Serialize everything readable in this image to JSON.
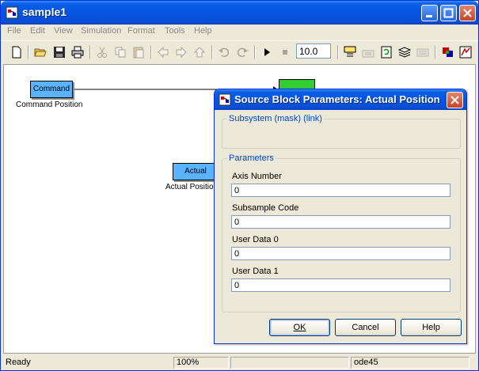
{
  "window": {
    "title": "sample1",
    "icon": "simulink-model-icon"
  },
  "menu": [
    "File",
    "Edit",
    "View",
    "Simulation",
    "Format",
    "Tools",
    "Help"
  ],
  "toolbar": {
    "stop_time": "10.0"
  },
  "canvas": {
    "blocks": [
      {
        "text": "Command",
        "label": "Command Position"
      },
      {
        "text": "Actual",
        "label": "Actual Positio"
      }
    ]
  },
  "status": {
    "state": "Ready",
    "zoom": "100%",
    "blank": "",
    "solver": "ode45"
  },
  "dialog": {
    "title": "Source Block Parameters: Actual Position",
    "subsystem_legend": "Subsystem (mask) (link)",
    "parameters_legend": "Parameters",
    "fields": [
      {
        "label": "Axis Number",
        "value": "0"
      },
      {
        "label": "Subsample Code",
        "value": "0"
      },
      {
        "label": "User Data 0",
        "value": "0"
      },
      {
        "label": "User Data 1",
        "value": "0"
      }
    ],
    "buttons": {
      "ok": "OK",
      "cancel": "Cancel",
      "help": "Help"
    }
  },
  "colors": {
    "block_fill": "#59b3ff",
    "block_green": "#33cc33",
    "titlebar_blue": "#0554e3",
    "legend_blue": "#0046d5"
  }
}
